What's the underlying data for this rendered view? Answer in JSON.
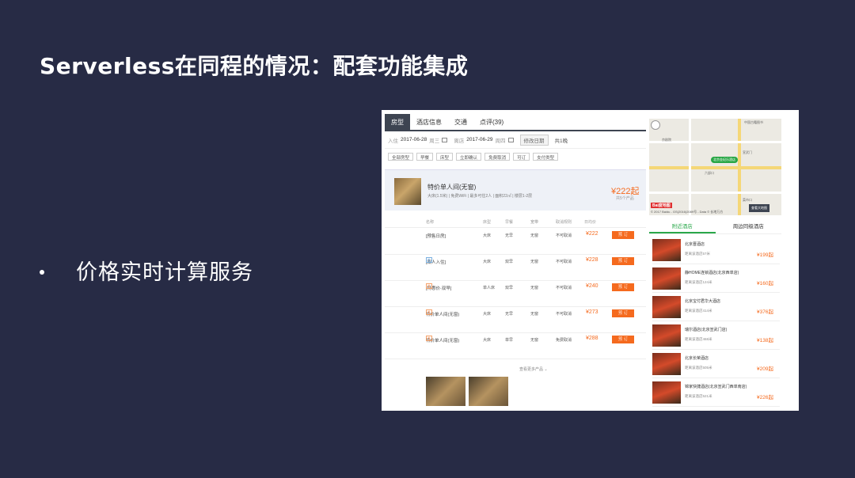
{
  "slide": {
    "title": "Serverless在同程的情况：配套功能集成",
    "bullet": "价格实时计算服务"
  },
  "shot": {
    "tabs": [
      "房型",
      "酒店信息",
      "交通",
      "点评(39)"
    ],
    "checkin_label": "入住",
    "checkin_date": "2017-06-28",
    "checkin_day": "周三",
    "checkout_label": "离店",
    "checkout_date": "2017-06-29",
    "checkout_day": "周四",
    "change_btn": "修改日期",
    "nights": "共1晚",
    "filters": [
      "全部房型",
      "早餐",
      "床型",
      "立即确认",
      "免费取消",
      "可订",
      "支付类型"
    ],
    "room": {
      "name": "特价单人间(无窗)",
      "desc": "大床(1.5米) | 免费WiFi | 最多可住2人 | 面积22㎡ | 楼层1-2层",
      "price": "¥222起",
      "price_sub": "共5个产品"
    },
    "col_headers": [
      "名称",
      "床型",
      "早餐",
      "宽带",
      "取消规则",
      "日均价"
    ],
    "rates": [
      {
        "name": "[预售日房]",
        "bed": "大床",
        "breakfast": "无早",
        "net": "无窗",
        "cancel": "不可取消",
        "price": "¥222",
        "book": "预 订",
        "pay": "在线付",
        "tag": ""
      },
      {
        "name": "[双人入住]",
        "bed": "大床",
        "breakfast": "双早",
        "net": "无窗",
        "cancel": "不可取消",
        "price": "¥228",
        "book": "预 订",
        "pay": "在线付",
        "tag": "礼"
      },
      {
        "name": "[特惠价-双早]",
        "bed": "单人床",
        "breakfast": "双早",
        "net": "无窗",
        "cancel": "不可取消",
        "price": "¥240",
        "book": "预 订",
        "pay": "在线付",
        "tag": "礼"
      },
      {
        "name": "特价单人间(无窗)",
        "bed": "大床",
        "breakfast": "无早",
        "net": "无窗",
        "cancel": "不可取消",
        "price": "¥273",
        "book": "预 订",
        "pay": "到店付",
        "tag": "礼"
      },
      {
        "name": "特价单人间(无窗)",
        "bed": "大床",
        "breakfast": "单早",
        "net": "无窗",
        "cancel": "免费取消",
        "price": "¥288",
        "book": "预 订",
        "pay": "到店付",
        "tag": "礼"
      }
    ],
    "more": "查看更多产品 ⌄",
    "map": {
      "pin": "北京金纪乐酒店",
      "badge": "Bai度地图",
      "copyright": "© 2017 Baidu - GS(2016)2089号 - Data © 长地万方",
      "button": "查看大地图",
      "labels": [
        "中国古籍图书",
        "京剧院",
        "六部口",
        "宣武门",
        "菜市口"
      ]
    },
    "near_tabs": [
      "附近酒店",
      "周边同级酒店"
    ],
    "nearby": [
      {
        "name": "北京晋酒店",
        "dist": "距离该酒店57米",
        "price": "¥199起"
      },
      {
        "name": "静HOME连锁酒店(北京西单店)",
        "dist": "距离该酒店124米",
        "price": "¥160起"
      },
      {
        "name": "北京宝付君华大酒店",
        "dist": "距离该酒店414米",
        "price": "¥376起"
      },
      {
        "name": "瑞尔酒店(北京宣武门店)",
        "dist": "距离该酒店468米",
        "price": "¥138起"
      },
      {
        "name": "北京长荣酒店",
        "dist": "距离该酒店505米",
        "price": "¥209起"
      },
      {
        "name": "锦家快捷酒店(北京宣武门西单南店)",
        "dist": "距离该酒店521米",
        "price": "¥226起"
      }
    ]
  }
}
